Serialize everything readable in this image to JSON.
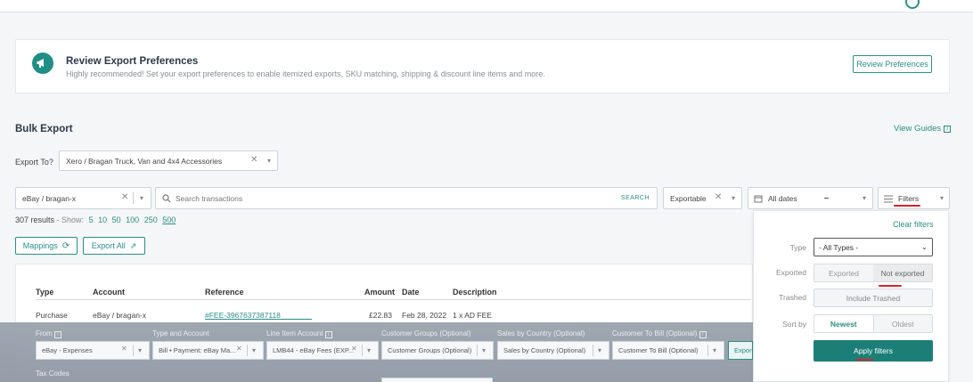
{
  "banner": {
    "title": "Review Export Preferences",
    "subtitle": "Highly recommended! Set your export preferences to enable itemized exports, SKU matching, shipping & discount line items and more.",
    "button": "Review Preferences"
  },
  "section": {
    "title": "Bulk Export",
    "view_guides": "View Guides",
    "guides_icon": "i"
  },
  "export_to": {
    "label": "Export To?",
    "value": "Xero / Bragan Truck, Van and 4x4 Accessories"
  },
  "filters_bar": {
    "account": "eBay / bragan-x",
    "search_placeholder": "Search transactions",
    "search_button": "SEARCH",
    "exportable": "Exportable",
    "dates": "All dates",
    "filters": "Filters"
  },
  "results": {
    "count": "307 results",
    "show_label": "- Show:",
    "page_sizes": [
      "5",
      "10",
      "50",
      "100",
      "250",
      "500"
    ]
  },
  "actions": {
    "mappings": "Mappings",
    "export_all": "Export All"
  },
  "table": {
    "headers": {
      "type": "Type",
      "account": "Account",
      "reference": "Reference",
      "amount": "Amount",
      "date": "Date",
      "description": "Description"
    },
    "rows": [
      {
        "type": "Purchase",
        "account": "eBay / bragan-x",
        "reference": "#FEE-3967637387118",
        "amount": "£22.83",
        "date": "Feb 28, 2022",
        "description": "1 x AD FEE"
      }
    ]
  },
  "mapping_form": {
    "from_label": "From",
    "from_value": "eBay - Expenses",
    "type_account_label": "Type and Account",
    "type_account_value": "Bill • Payment: eBay Ma...",
    "line_item_label": "Line Item Account",
    "line_item_value": "LMB44 - eBay Fees (EXP...",
    "customer_groups_label": "Customer Groups (Optional)",
    "customer_groups_value": "Customer Groups (Optional)",
    "sales_country_label": "Sales by Country (Optional)",
    "sales_country_value": "Sales by Country (Optional)",
    "customer_bill_label": "Customer To Bill (Optional)",
    "customer_bill_value": "Customer To Bill (Optional)",
    "export_button": "Export",
    "tax_label": "Tax Codes",
    "info_icon": "i"
  },
  "filters_panel": {
    "clear": "Clear filters",
    "type_label": "Type",
    "type_value": "- All Types -",
    "exported_label": "Exported",
    "exported_options": [
      "Exported",
      "Not exported"
    ],
    "trashed_label": "Trashed",
    "trashed_option": "Include Trashed",
    "sort_label": "Sort by",
    "sort_options": [
      "Newest",
      "Oldest"
    ],
    "apply": "Apply filters"
  },
  "colors": {
    "accent": "#2a8f87",
    "apply_button": "#1c7f77",
    "annotation_red": "#d3242a"
  }
}
